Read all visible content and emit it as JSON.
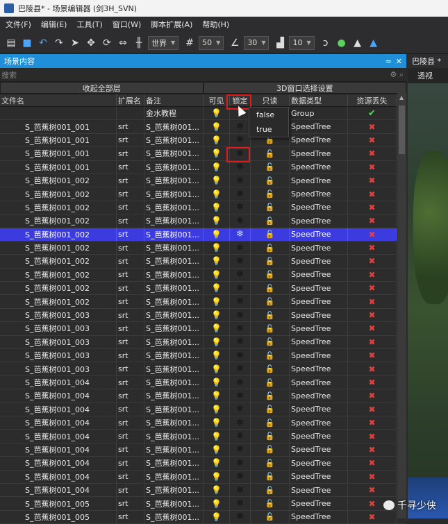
{
  "window": {
    "title": "巴陵县* - 场景编辑器 (剑3H_SVN)"
  },
  "menu": [
    "文件(F)",
    "编辑(E)",
    "工具(T)",
    "窗口(W)",
    "脚本扩展(A)",
    "帮助(H)"
  ],
  "toolbar": {
    "space_dropdown": "世界",
    "grid_value": "50",
    "angle_value": "30",
    "step_value": "10"
  },
  "panel": {
    "title": "场景内容",
    "search_placeholder": "搜索",
    "collapse_button": "收起全部层",
    "select_3d_button": "3D窗口选择设置",
    "columns": [
      "文件名",
      "扩展名",
      "备注",
      "可见",
      "锁定",
      "只读",
      "数据类型",
      "资源丢失"
    ]
  },
  "rows": [
    {
      "name": "",
      "ext": "",
      "note": "金水教程",
      "type": "Group",
      "missing": "ok"
    },
    {
      "name": "S_芭蕉树001_001",
      "ext": "srt",
      "note": "S_芭蕉树001...",
      "type": "SpeedTree",
      "missing": "x"
    },
    {
      "name": "S_芭蕉树001_001",
      "ext": "srt",
      "note": "S_芭蕉树001...",
      "type": "SpeedTree",
      "missing": "x"
    },
    {
      "name": "S_芭蕉树001_001",
      "ext": "srt",
      "note": "S_芭蕉树001...",
      "type": "SpeedTree",
      "missing": "x"
    },
    {
      "name": "S_芭蕉树001_001",
      "ext": "srt",
      "note": "S_芭蕉树001...",
      "type": "SpeedTree",
      "missing": "x"
    },
    {
      "name": "S_芭蕉树001_002",
      "ext": "srt",
      "note": "S_芭蕉树001...",
      "type": "SpeedTree",
      "missing": "x"
    },
    {
      "name": "S_芭蕉树001_002",
      "ext": "srt",
      "note": "S_芭蕉树001...",
      "type": "SpeedTree",
      "missing": "x"
    },
    {
      "name": "S_芭蕉树001_002",
      "ext": "srt",
      "note": "S_芭蕉树001...",
      "type": "SpeedTree",
      "missing": "x"
    },
    {
      "name": "S_芭蕉树001_002",
      "ext": "srt",
      "note": "S_芭蕉树001...",
      "type": "SpeedTree",
      "missing": "x"
    },
    {
      "name": "S_芭蕉树001_002",
      "ext": "srt",
      "note": "S_芭蕉树001...",
      "type": "SpeedTree",
      "missing": "x",
      "selected": true
    },
    {
      "name": "S_芭蕉树001_002",
      "ext": "srt",
      "note": "S_芭蕉树001...",
      "type": "SpeedTree",
      "missing": "x"
    },
    {
      "name": "S_芭蕉树001_002",
      "ext": "srt",
      "note": "S_芭蕉树001...",
      "type": "SpeedTree",
      "missing": "x"
    },
    {
      "name": "S_芭蕉树001_002",
      "ext": "srt",
      "note": "S_芭蕉树001...",
      "type": "SpeedTree",
      "missing": "x"
    },
    {
      "name": "S_芭蕉树001_002",
      "ext": "srt",
      "note": "S_芭蕉树001...",
      "type": "SpeedTree",
      "missing": "x"
    },
    {
      "name": "S_芭蕉树001_002",
      "ext": "srt",
      "note": "S_芭蕉树001...",
      "type": "SpeedTree",
      "missing": "x"
    },
    {
      "name": "S_芭蕉树001_003",
      "ext": "srt",
      "note": "S_芭蕉树001...",
      "type": "SpeedTree",
      "missing": "x"
    },
    {
      "name": "S_芭蕉树001_003",
      "ext": "srt",
      "note": "S_芭蕉树001...",
      "type": "SpeedTree",
      "missing": "x"
    },
    {
      "name": "S_芭蕉树001_003",
      "ext": "srt",
      "note": "S_芭蕉树001...",
      "type": "SpeedTree",
      "missing": "x"
    },
    {
      "name": "S_芭蕉树001_003",
      "ext": "srt",
      "note": "S_芭蕉树001...",
      "type": "SpeedTree",
      "missing": "x"
    },
    {
      "name": "S_芭蕉树001_003",
      "ext": "srt",
      "note": "S_芭蕉树001...",
      "type": "SpeedTree",
      "missing": "x"
    },
    {
      "name": "S_芭蕉树001_004",
      "ext": "srt",
      "note": "S_芭蕉树001...",
      "type": "SpeedTree",
      "missing": "x"
    },
    {
      "name": "S_芭蕉树001_004",
      "ext": "srt",
      "note": "S_芭蕉树001...",
      "type": "SpeedTree",
      "missing": "x"
    },
    {
      "name": "S_芭蕉树001_004",
      "ext": "srt",
      "note": "S_芭蕉树001...",
      "type": "SpeedTree",
      "missing": "x"
    },
    {
      "name": "S_芭蕉树001_004",
      "ext": "srt",
      "note": "S_芭蕉树001...",
      "type": "SpeedTree",
      "missing": "x"
    },
    {
      "name": "S_芭蕉树001_004",
      "ext": "srt",
      "note": "S_芭蕉树001...",
      "type": "SpeedTree",
      "missing": "x"
    },
    {
      "name": "S_芭蕉树001_004",
      "ext": "srt",
      "note": "S_芭蕉树001...",
      "type": "SpeedTree",
      "missing": "x"
    },
    {
      "name": "S_芭蕉树001_004",
      "ext": "srt",
      "note": "S_芭蕉树001...",
      "type": "SpeedTree",
      "missing": "x"
    },
    {
      "name": "S_芭蕉树001_004",
      "ext": "srt",
      "note": "S_芭蕉树001...",
      "type": "SpeedTree",
      "missing": "x"
    },
    {
      "name": "S_芭蕉树001_004",
      "ext": "srt",
      "note": "S_芭蕉树001...",
      "type": "SpeedTree",
      "missing": "x"
    },
    {
      "name": "S_芭蕉树001_005",
      "ext": "srt",
      "note": "S_芭蕉树001...",
      "type": "SpeedTree",
      "missing": "x"
    },
    {
      "name": "S_芭蕉树001_005",
      "ext": "srt",
      "note": "S_芭蕉树001...",
      "type": "SpeedTree",
      "missing": "x"
    }
  ],
  "popup": {
    "options": [
      "false",
      "true"
    ]
  },
  "viewport": {
    "tab_title": "巴陵县 *",
    "view_mode": "透视"
  },
  "watermark": {
    "text": "千寻少侠"
  },
  "icons": {
    "visible": "bulb-icon",
    "locked": "snowflake-icon",
    "readonly": "unlock-icon",
    "missing_ok": "check-icon",
    "missing_x": "x-icon"
  },
  "colors": {
    "panel_title": "#1e8fd8",
    "selected_row": "#3b3be0",
    "highlight_box": "#e01b1b"
  }
}
